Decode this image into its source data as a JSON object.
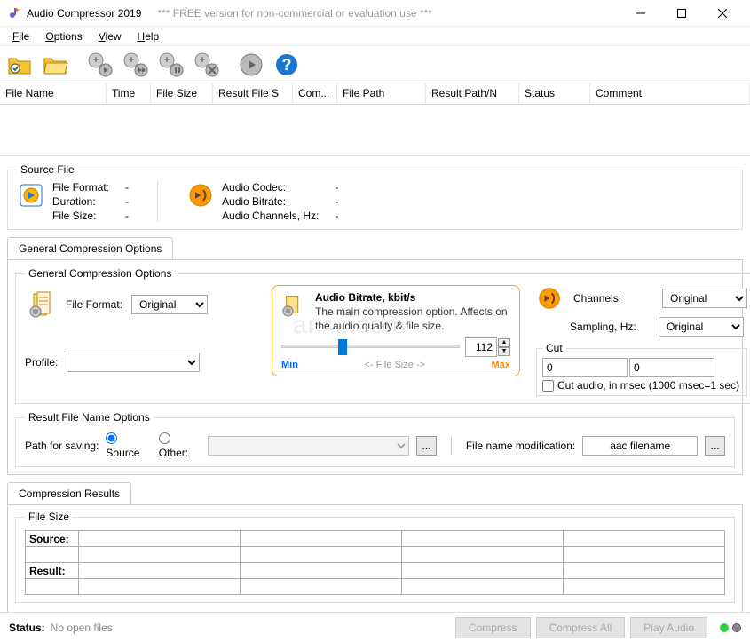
{
  "title": "Audio Compressor 2019",
  "subtitle": "*** FREE version for non-commercial or evaluation use ***",
  "menu": {
    "file": "File",
    "options": "Options",
    "view": "View",
    "help": "Help"
  },
  "columns": {
    "fileName": "File Name",
    "time": "Time",
    "fileSize": "File Size",
    "resultFileSize": "Result File S",
    "comp": "Com...",
    "filePath": "File Path",
    "resultPath": "Result Path/N",
    "status": "Status",
    "comment": "Comment"
  },
  "sourceFile": {
    "legend": "Source File",
    "fileFormatLabel": "File Format:",
    "fileFormat": "-",
    "durationLabel": "Duration:",
    "duration": "-",
    "fileSizeLabel": "File Size:",
    "fileSize": "-",
    "audioCodecLabel": "Audio Codec:",
    "audioCodec": "-",
    "audioBitrateLabel": "Audio Bitrate:",
    "audioBitrate": "-",
    "audioChannelsLabel": "Audio Channels, Hz:",
    "audioChannels": "-"
  },
  "gco": {
    "tab": "General Compression Options",
    "legend": "General Compression Options",
    "fileFormatLabel": "File Format:",
    "fileFormat": "Original",
    "profileLabel": "Profile:",
    "bitrateTitle": "Audio Bitrate, kbit/s",
    "bitrateDesc": "The main compression option. Affects on the audio quality & file size.",
    "bitrateValue": "112",
    "min": "Min",
    "mid": "<-  File Size   ->",
    "max": "Max",
    "channelsLabel": "Channels:",
    "channels": "Original",
    "samplingLabel": "Sampling, Hz:",
    "sampling": "Original",
    "cutLegend": "Cut",
    "cutFrom": "0",
    "cutTo": "0",
    "cutCheck": "Cut audio, in msec (1000 msec=1 sec)"
  },
  "rfno": {
    "legend": "Result File Name Options",
    "pathLabel": "Path for saving:",
    "source": "Source",
    "other": "Other:",
    "fnameModLabel": "File name modification:",
    "fnameMod": "aac filename"
  },
  "results": {
    "tab": "Compression Results",
    "legend": "File Size",
    "source": "Source:",
    "result": "Result:"
  },
  "status": {
    "label": "Status:",
    "text": "No open files",
    "compress": "Compress",
    "compressAll": "Compress All",
    "playAudio": "Play Audio"
  }
}
